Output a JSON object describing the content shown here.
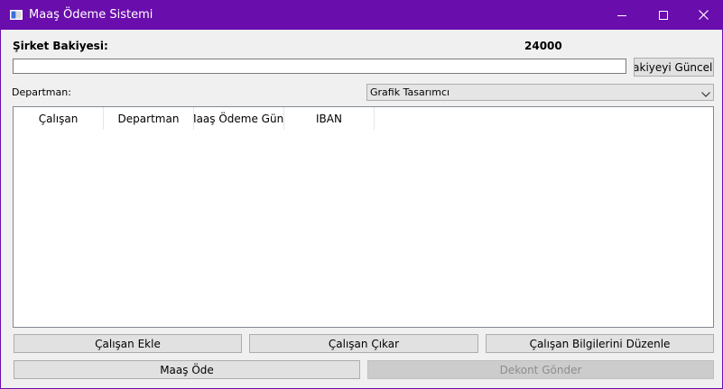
{
  "window": {
    "title": "Maaş Ödeme Sistemi",
    "accent_color": "#6a0dad",
    "icons": [
      "app-window-icon",
      "minimize-icon",
      "maximize-icon",
      "close-icon"
    ]
  },
  "balance": {
    "label": "Şirket Bakiyesi:",
    "value": "24000",
    "input_value": "",
    "update_button": "Bakiyeyi Güncelle"
  },
  "department": {
    "label": "Departman:",
    "selected": "Grafik Tasarımcı"
  },
  "table": {
    "columns": [
      "Çalışan",
      "Departman",
      "Maaş Ödeme Günü",
      "IBAN"
    ],
    "rows": []
  },
  "actions": {
    "add_employee": "Çalışan Ekle",
    "remove_employee": "Çalışan Çıkar",
    "edit_employee": "Çalışan Bilgilerini Düzenle",
    "pay_salary": "Maaş Öde",
    "send_receipt": "Dekont Gönder"
  }
}
